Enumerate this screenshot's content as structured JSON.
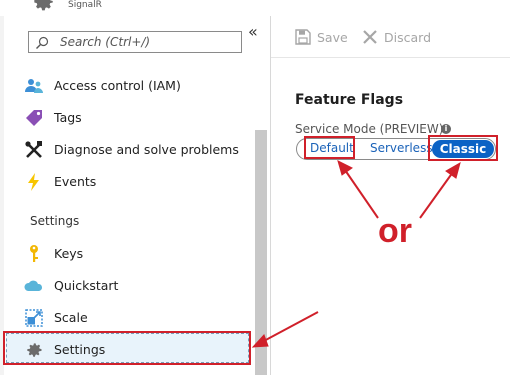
{
  "header": {
    "subtitle": "SignalR",
    "gear_icon": "gear-icon"
  },
  "sidebar": {
    "collapse_glyph": "«",
    "search": {
      "placeholder": "Search (Ctrl+/)",
      "icon": "search-icon"
    },
    "items": [
      {
        "label": "Access control (IAM)",
        "icon": "people-icon"
      },
      {
        "label": "Tags",
        "icon": "tag-icon"
      },
      {
        "label": "Diagnose and solve problems",
        "icon": "wrench-icon"
      },
      {
        "label": "Events",
        "icon": "lightning-icon"
      }
    ],
    "section_header": "Settings",
    "settings_items": [
      {
        "label": "Keys",
        "icon": "key-icon"
      },
      {
        "label": "Quickstart",
        "icon": "cloud-icon"
      },
      {
        "label": "Scale",
        "icon": "scale-icon"
      },
      {
        "label": "Settings",
        "icon": "gear-icon",
        "selected": true
      }
    ]
  },
  "toolbar": {
    "save_label": "Save",
    "discard_label": "Discard"
  },
  "main": {
    "title": "Feature Flags",
    "service_mode_label": "Service Mode (PREVIEW)",
    "info_glyph": "i",
    "options": [
      "Default",
      "Serverless",
      "Classic"
    ],
    "selected_option": "Classic"
  },
  "annotation": {
    "text": "or",
    "color": "#d0202a"
  },
  "colors": {
    "accent": "#0b62c5",
    "highlight": "#d0202a",
    "selected_bg": "#e8f3fb"
  }
}
